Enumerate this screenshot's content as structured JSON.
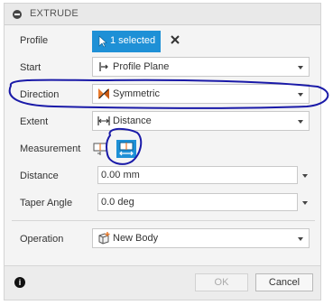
{
  "dialog": {
    "title": "EXTRUDE"
  },
  "profile": {
    "label": "Profile",
    "selection": "1 selected"
  },
  "start": {
    "label": "Start",
    "value": "Profile Plane"
  },
  "direction": {
    "label": "Direction",
    "value": "Symmetric"
  },
  "extent": {
    "label": "Extent",
    "value": "Distance"
  },
  "measurement": {
    "label": "Measurement"
  },
  "distance": {
    "label": "Distance",
    "value": "0.00 mm"
  },
  "taper": {
    "label": "Taper Angle",
    "value": "0.0 deg"
  },
  "operation": {
    "label": "Operation",
    "value": "New Body"
  },
  "footer": {
    "ok_label": "OK",
    "cancel_label": "Cancel"
  },
  "colors": {
    "accent": "#1e90d6",
    "annotation": "#1a1aa8"
  },
  "icons": [
    "minimize-icon",
    "cursor-arrow-icon",
    "close-icon",
    "profile-plane-icon",
    "symmetric-icon",
    "distance-icon",
    "measurement-half-icon",
    "measurement-whole-icon",
    "new-body-icon",
    "info-icon",
    "chevron-down-icon"
  ]
}
